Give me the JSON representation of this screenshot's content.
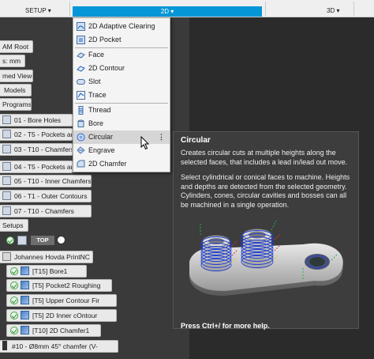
{
  "toolbar": {
    "setup_label": "SETUP ▾",
    "twod_label": "2D ▾",
    "threed_label": "3D ▾"
  },
  "tree": {
    "items": [
      {
        "label": "AM Root"
      },
      {
        "label": "s: mm"
      },
      {
        "label": "med Views"
      },
      {
        "label": "Models"
      },
      {
        "label": "Programs"
      },
      {
        "label": "01 - Bore Holes"
      },
      {
        "label": "02 - T5 - Pockets an"
      },
      {
        "label": "03 - T10 - Chamfers"
      },
      {
        "label": "04 - T5 - Pockets an"
      },
      {
        "label": "05 - T10 - Inner Chamfers"
      },
      {
        "label": "06 - T1 - Outer Contours"
      },
      {
        "label": "07 - T10 - Chamfers"
      },
      {
        "label": "Setups"
      },
      {
        "label": "TOP"
      },
      {
        "label": "Johannes Hovda PrintNC"
      },
      {
        "label": "[T15] Bore1"
      },
      {
        "label": "[T5] Pocket2 Roughing"
      },
      {
        "label": "[T5] Upper Contour Fir"
      },
      {
        "label": "[T5] 2D Inner cOntour"
      },
      {
        "label": "[T10] 2D Chamfer1"
      },
      {
        "label": "#10 - Ø8mm 45° chamfer (V-"
      }
    ]
  },
  "menu": {
    "items": [
      {
        "label": "2D Adaptive Clearing",
        "icon": "adaptive-clearing-icon"
      },
      {
        "label": "2D Pocket",
        "icon": "pocket-icon"
      },
      {
        "label": "Face",
        "icon": "face-icon"
      },
      {
        "label": "2D Contour",
        "icon": "contour-icon"
      },
      {
        "label": "Slot",
        "icon": "slot-icon"
      },
      {
        "label": "Trace",
        "icon": "trace-icon"
      },
      {
        "label": "Thread",
        "icon": "thread-icon"
      },
      {
        "label": "Bore",
        "icon": "bore-icon"
      },
      {
        "label": "Circular",
        "icon": "circular-icon"
      },
      {
        "label": "Engrave",
        "icon": "engrave-icon"
      },
      {
        "label": "2D Chamfer",
        "icon": "chamfer-icon"
      }
    ],
    "more_label": "⋮"
  },
  "tooltip": {
    "title": "Circular",
    "p1": "Creates circular cuts at multiple heights along the selected faces, that includes a lead in/lead out move.",
    "p2": "Select cylindrical or conical faces to machine. Heights and depths are detected from the selected geometry. Cylinders, cones, circular cavities and bosses can all be machined in a single operation.",
    "help": "Press Ctrl+/ for more help."
  },
  "colors": {
    "accent": "#0696d7",
    "menu_bg": "#f4f4f4",
    "tooltip_bg": "#3d3d3d",
    "toolpath_blue": "#1f3fd1"
  }
}
